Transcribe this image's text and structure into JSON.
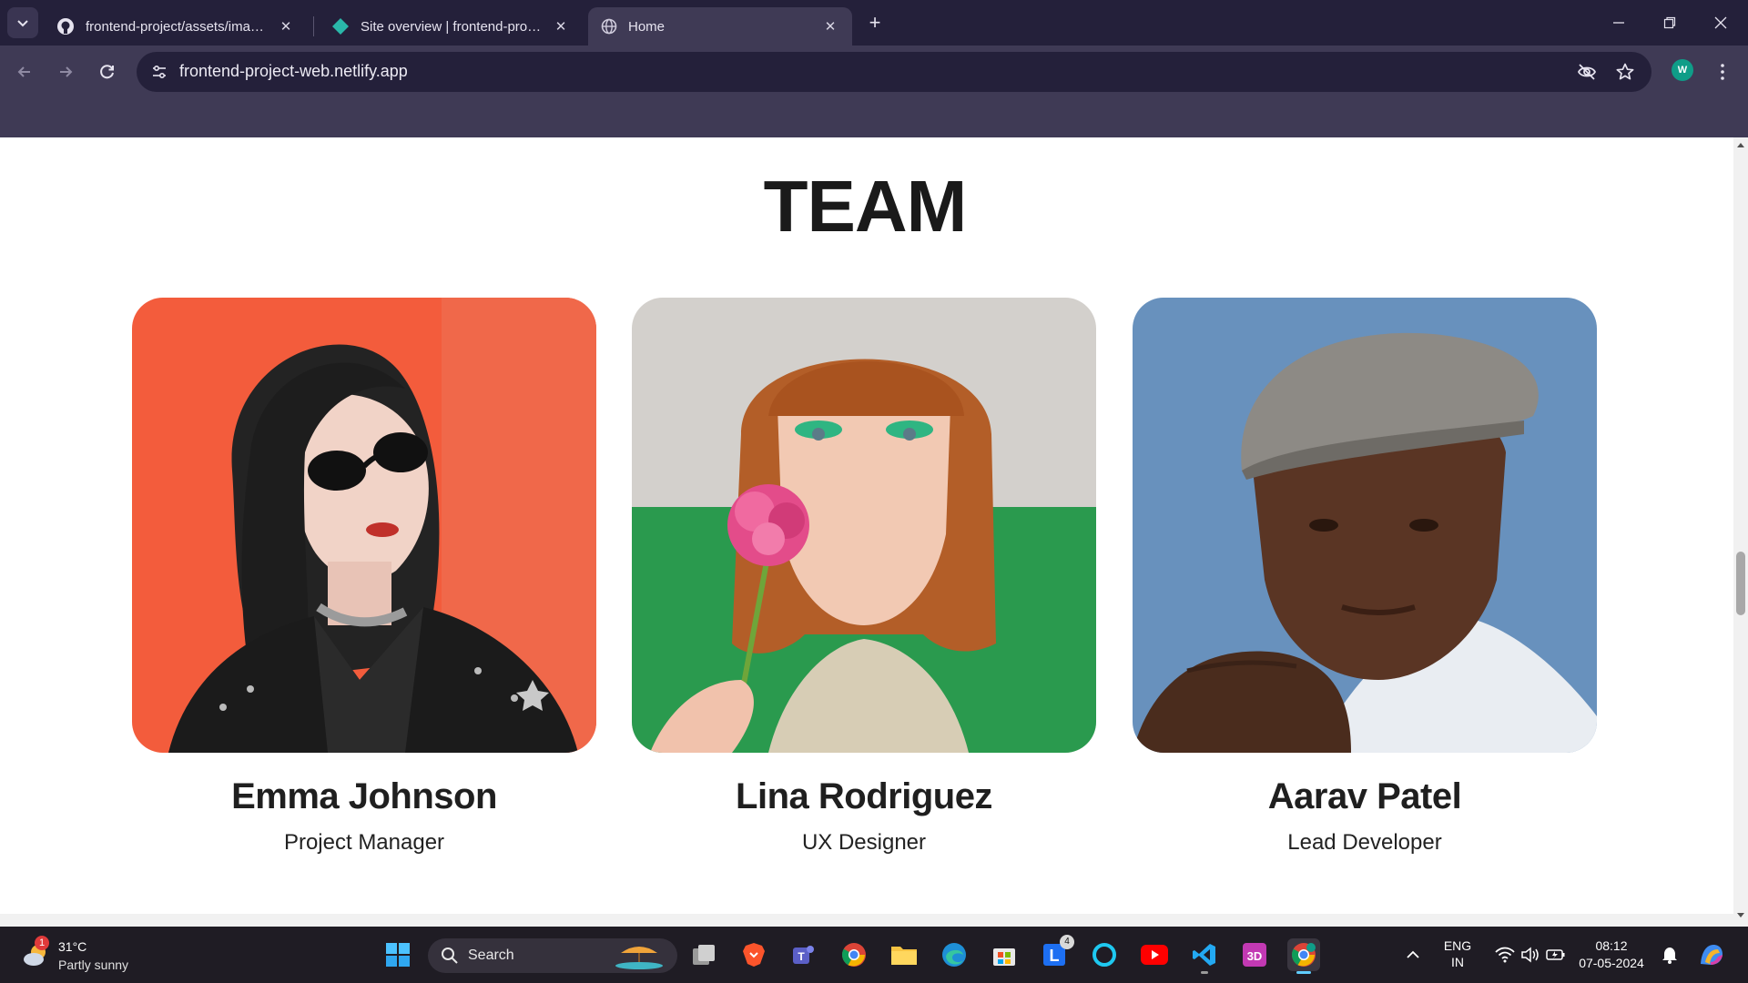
{
  "browser": {
    "tabs": [
      {
        "title": "frontend-project/assets/images",
        "icon": "github-icon",
        "active": false
      },
      {
        "title": "Site overview | frontend-project",
        "icon": "netlify-icon",
        "active": false
      },
      {
        "title": "Home",
        "icon": "globe-icon",
        "active": true
      }
    ],
    "url": "frontend-project-web.netlify.app",
    "profile_initial": "W"
  },
  "page": {
    "heading": "TEAM",
    "members": [
      {
        "name": "Emma Johnson",
        "role": "Project Manager",
        "photo_bg": "#f35c3c"
      },
      {
        "name": "Lina Rodriguez",
        "role": "UX Designer",
        "photo_bg": "#2a9a4e"
      },
      {
        "name": "Aarav Patel",
        "role": "Lead Developer",
        "photo_bg": "#6891bd"
      }
    ]
  },
  "taskbar": {
    "weather": {
      "temp": "31°C",
      "condition": "Partly sunny",
      "alerts": "1"
    },
    "search_label": "Search",
    "apps": [
      "start-icon",
      "task-view-icon",
      "brave-icon",
      "teams-icon",
      "chrome-icon",
      "file-explorer-icon",
      "edge-icon",
      "store-icon",
      "loom-icon",
      "cortana-icon",
      "youtube-icon",
      "vscode-icon",
      "3d-viewer-icon",
      "chrome-profile-icon"
    ],
    "loom_badge": "4",
    "language_line1": "ENG",
    "language_line2": "IN",
    "time": "08:12",
    "date": "07-05-2024"
  }
}
